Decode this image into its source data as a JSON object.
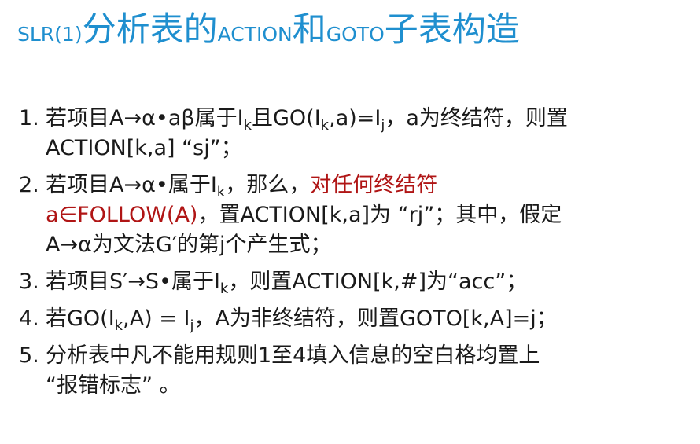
{
  "title": {
    "p1": "SLR(1)",
    "p2": "分析表的",
    "p3": "ACTION",
    "p4": "和",
    "p5": "GOTO",
    "p6": "子表构造"
  },
  "items": [
    {
      "num": "1.",
      "l1a": "若项目A→α•aβ属于I",
      "l1sub": "k",
      "l1b": "且GO(I",
      "l1sub2": "k",
      "l1c": ",a)=I",
      "l1sub3": "j",
      "l1d": "，a为终结符，则置",
      "l2": "ACTION[k,a] “sj”；"
    },
    {
      "num": "2.",
      "l1a": "若项目A→α•属于I",
      "l1sub": "k",
      "l1b": "，那么，",
      "l1red": "对任何终结符",
      "l2red": "a∈FOLLOW(A)",
      "l2b": "，置ACTION[k,a]为 “rj”；其中，假定",
      "l3": "A→α为文法G′的第j个产生式；"
    },
    {
      "num": "3.",
      "l1a": "若项目S′→S•属于I",
      "l1sub": "k",
      "l1b": "，则置ACTION[k,#]为“acc”；"
    },
    {
      "num": "4.",
      "l1a": "若GO(I",
      "l1sub": "k",
      "l1b": ",A) = I",
      "l1sub2": "j",
      "l1c": "，A为非终结符，则置GOTO[k,A]=j；"
    },
    {
      "num": "5.",
      "l1a": "分析表中凡不能用规则1至4填入信息的空白格均置上",
      "l2": "“报错标志” 。"
    }
  ],
  "colors": {
    "title": "#1f8fcf",
    "text": "#1a1a1a",
    "highlight": "#b01515"
  }
}
